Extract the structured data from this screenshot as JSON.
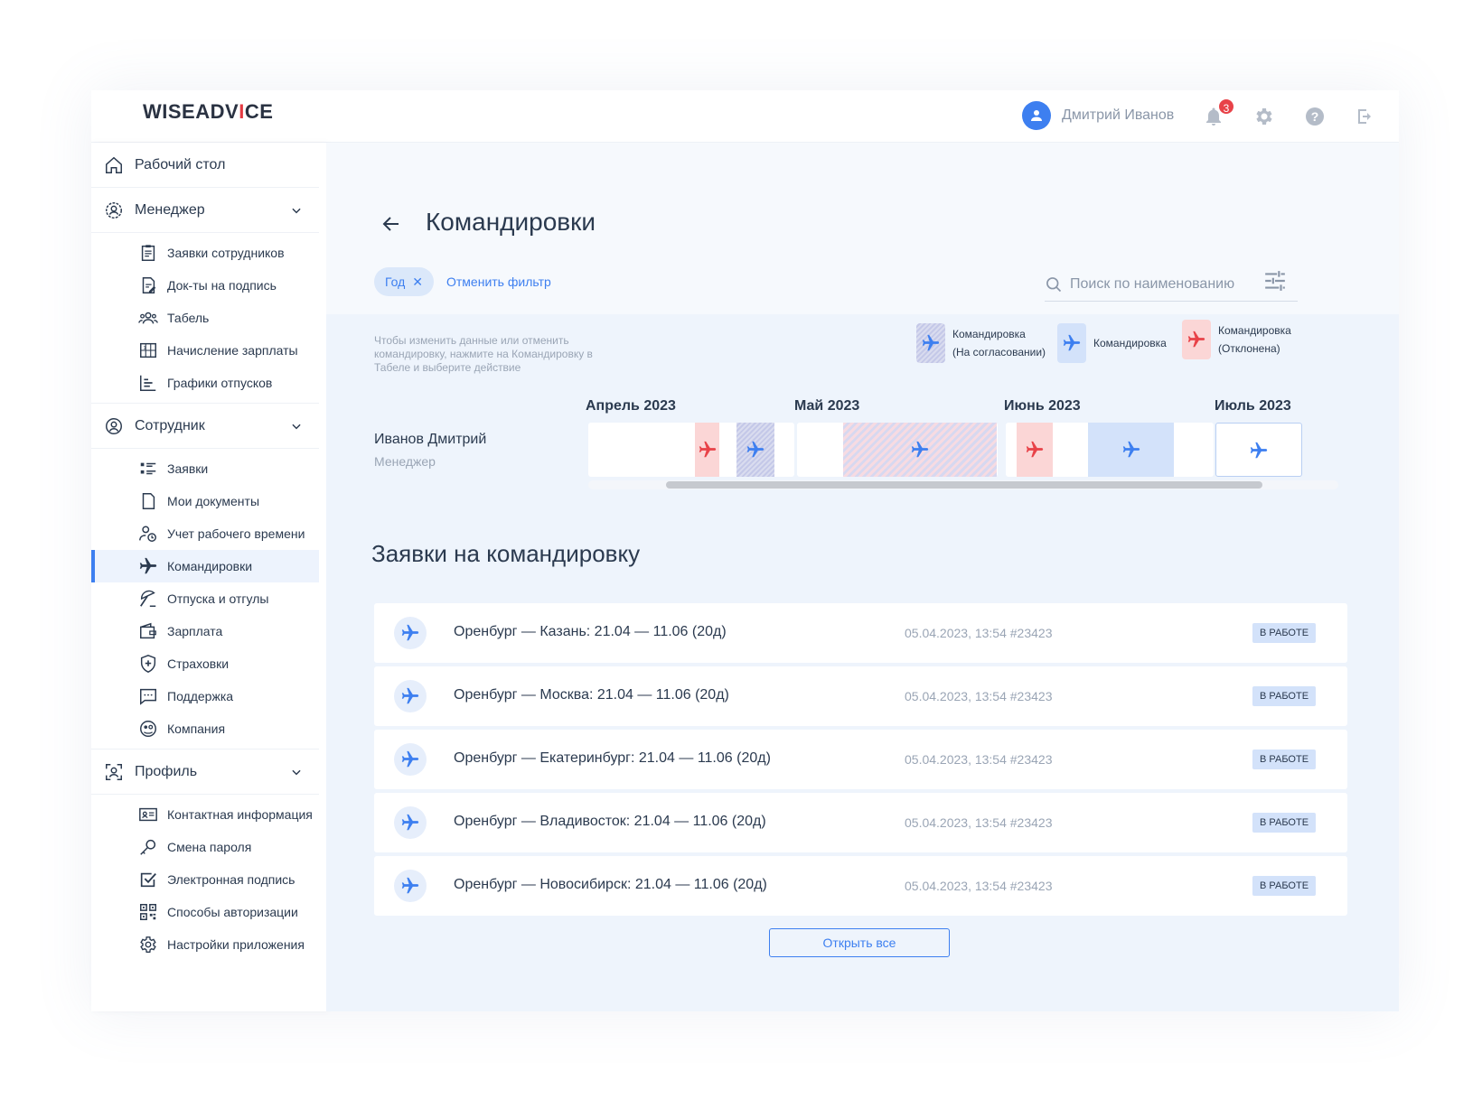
{
  "header": {
    "logo_prefix": "WISEADV",
    "logo_accent": "I",
    "logo_suffix": "CE",
    "user_name": "Дмитрий Иванов",
    "notification_count": "3"
  },
  "sidebar": {
    "home": "Рабочий стол",
    "manager": {
      "label": "Менеджер",
      "items": [
        "Заявки сотрудников",
        "Док-ты на подпись",
        "Табель",
        "Начисление зарплаты",
        "Графики отпусков"
      ]
    },
    "employee": {
      "label": "Сотрудник",
      "items": [
        "Заявки",
        "Мои документы",
        "Учет рабочего времени",
        "Командировки",
        "Отпуска и отгулы",
        "Зарплата",
        "Страховки",
        "Поддержка",
        "Компания"
      ]
    },
    "profile": {
      "label": "Профиль",
      "items": [
        "Контактная информация",
        "Смена пароля",
        "Электронная подпись",
        "Способы авторизации",
        "Настройки приложения"
      ]
    }
  },
  "page": {
    "title": "Командировки",
    "filter_chip": "Год",
    "cancel_filter": "Отменить фильтр",
    "search_placeholder": "Поиск по наименованию",
    "hint": "Чтобы изменить данные или отменить командировку, нажмите на Командировку в Табеле и выберите действие"
  },
  "legend": {
    "pending_line1": "Командировка",
    "pending_line2": "(На согласовании)",
    "approved": "Командировка",
    "rejected_line1": "Командировка",
    "rejected_line2": "(Отклонена)"
  },
  "timeline": {
    "employee_name": "Иванов Дмитрий",
    "employee_role": "Менеджер",
    "months": [
      "Апрель 2023",
      "Май 2023",
      "Июнь 2023",
      "Июль 2023"
    ]
  },
  "requests": {
    "title": "Заявки на командировку",
    "rows": [
      {
        "title": "Оренбург — Казань: 21.04 — 11.06 (20д)",
        "meta": "05.04.2023, 13:54  #23423",
        "status": "В РАБОТЕ"
      },
      {
        "title": "Оренбург — Москва: 21.04 — 11.06 (20д)",
        "meta": "05.04.2023, 13:54  #23423",
        "status": "В РАБОТЕ"
      },
      {
        "title": "Оренбург — Екатеринбург: 21.04 — 11.06 (20д)",
        "meta": "05.04.2023, 13:54  #23423",
        "status": "В РАБОТЕ"
      },
      {
        "title": "Оренбург — Владивосток: 21.04 — 11.06 (20д)",
        "meta": "05.04.2023, 13:54  #23423",
        "status": "В РАБОТЕ"
      },
      {
        "title": "Оренбург — Новосибирск: 21.04 — 11.06 (20д)",
        "meta": "05.04.2023, 13:54  #23423",
        "status": "В РАБОТЕ"
      }
    ],
    "open_all": "Открыть все"
  },
  "colors": {
    "accent": "#3d7ff0",
    "rejected": "#e84248",
    "approved_bg": "#d3e2fa",
    "rejected_bg": "#fbd6d6"
  }
}
